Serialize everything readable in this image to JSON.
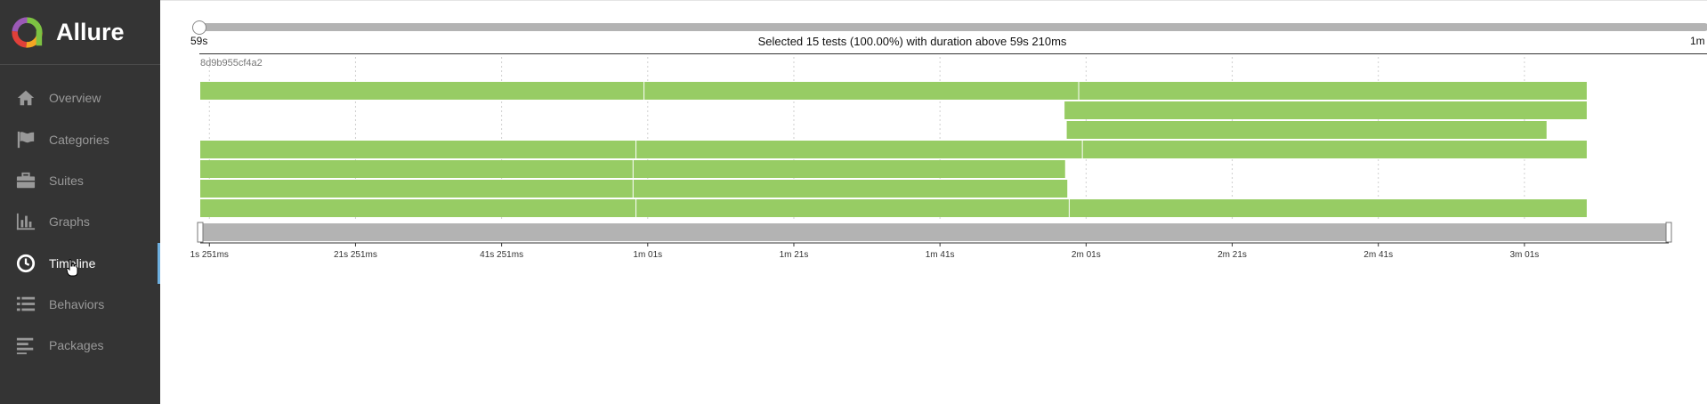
{
  "app": {
    "name": "Allure",
    "colors": {
      "sidebar_bg": "#343434",
      "accent": "#6eb0e0",
      "passed": "#97cc64",
      "brush": "#b3b3b3"
    },
    "logo_icon": "allure-ring-logo"
  },
  "sidebar": {
    "items": [
      {
        "label": "Overview",
        "icon": "home-icon",
        "active": false
      },
      {
        "label": "Categories",
        "icon": "flag-icon",
        "active": false
      },
      {
        "label": "Suites",
        "icon": "briefcase-icon",
        "active": false
      },
      {
        "label": "Graphs",
        "icon": "bar-chart-icon",
        "active": false
      },
      {
        "label": "Timeline",
        "icon": "clock-icon",
        "active": true
      },
      {
        "label": "Behaviors",
        "icon": "list-icon",
        "active": false
      },
      {
        "label": "Packages",
        "icon": "align-left-icon",
        "active": false
      }
    ]
  },
  "duration_filter": {
    "min_label": "59s",
    "max_label": "1m",
    "caption": "Selected 15 tests (100.00%) with duration above 59s 210ms",
    "handle_position": 0.0
  },
  "timeline": {
    "host": "8d9b955cf4a2",
    "brush_selection": [
      0.0,
      1.0
    ],
    "chart_data": {
      "type": "bar",
      "orientation": "timeline",
      "x_unit": "seconds",
      "x_range": [
        0,
        201
      ],
      "tick_labels": [
        "1s 251ms",
        "21s 251ms",
        "41s 251ms",
        "1m 01s",
        "1m 21s",
        "1m 41s",
        "2m 01s",
        "2m 21s",
        "2m 41s",
        "3m 01s"
      ],
      "tick_values": [
        1.25,
        21.25,
        41.25,
        61.25,
        81.25,
        101.25,
        121.25,
        141.25,
        161.25,
        181.25
      ],
      "lanes": [
        {
          "segments": [
            [
              0,
              60.8
            ],
            [
              60.8,
              120.3
            ],
            [
              120.3,
              189.9
            ]
          ]
        },
        {
          "segments": [
            [
              118.3,
              189.9
            ]
          ]
        },
        {
          "segments": [
            [
              118.6,
              184.4
            ]
          ]
        },
        {
          "segments": [
            [
              0,
              59.7
            ],
            [
              59.7,
              120.8
            ],
            [
              120.8,
              189.9
            ]
          ]
        },
        {
          "segments": [
            [
              0,
              59.3
            ],
            [
              59.3,
              118.5
            ]
          ]
        },
        {
          "segments": [
            [
              0,
              59.3
            ],
            [
              59.3,
              118.8
            ]
          ]
        },
        {
          "segments": [
            [
              0,
              59.7
            ],
            [
              59.7,
              119.0
            ],
            [
              119.0,
              189.9
            ]
          ]
        }
      ]
    }
  }
}
